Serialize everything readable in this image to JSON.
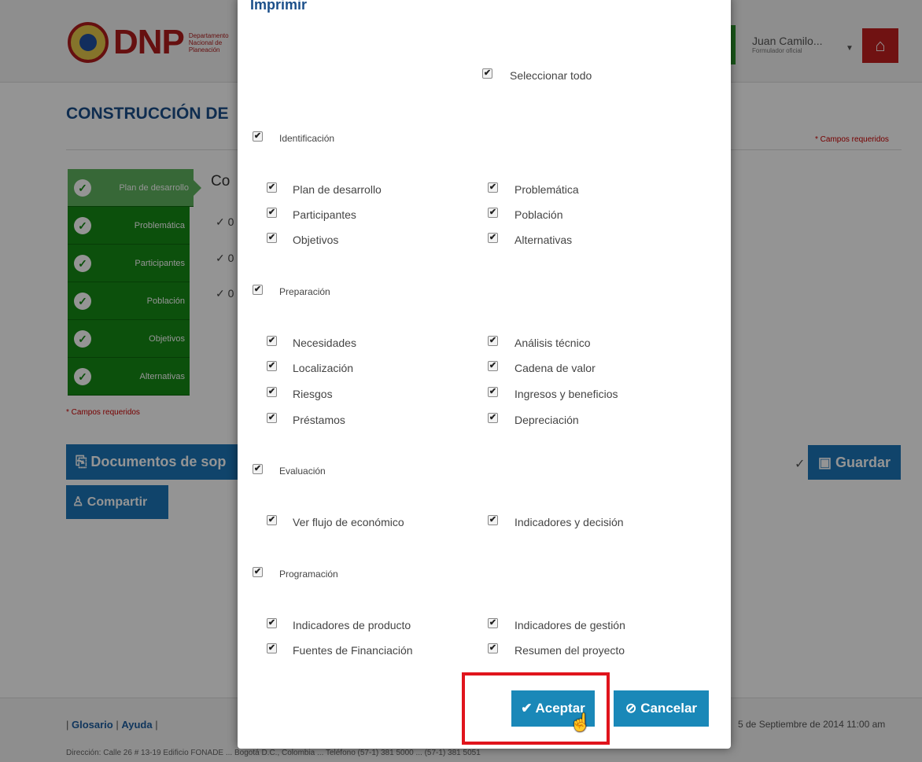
{
  "header": {
    "logo_text": "DNP",
    "logo_subtitle": "Departamento Nacional de Planeación",
    "user_name": "Juan Camilo...",
    "user_role": "Formulador oficial",
    "home_icon": "home-icon"
  },
  "page": {
    "title": "CONSTRUCCIÓN DE",
    "subtitle": "Co",
    "required_right": "* Campos requeridos",
    "required_left": "* Campos requeridos",
    "checks": [
      "✓ 0",
      "✓ 0",
      "✓ 0"
    ],
    "steps": [
      "Plan de desarrollo",
      "Problemática",
      "Participantes",
      "Población",
      "Objetivos",
      "Alternativas"
    ],
    "docs_button": "Documentos de sop",
    "share_button": "Compartir",
    "save_button": "Guardar"
  },
  "footer": {
    "glossary": "Glosario",
    "help": "Ayuda",
    "date": "5 de Septiembre de 2014 11:00 am",
    "address": "Dirección: Calle 26 # 13-19 Edificio FONADE ... Bogotá D.C., Colombia ... Teléfono (57-1) 381 5000 ... (57-1) 381 5051"
  },
  "modal": {
    "title": "Imprimir",
    "select_all": "Seleccionar todo",
    "sections": [
      {
        "label": "Identificación",
        "left": [
          "Plan de desarrollo",
          "Participantes",
          "Objetivos"
        ],
        "right": [
          "Problemática",
          "Población",
          "Alternativas"
        ]
      },
      {
        "label": "Preparación",
        "left": [
          "Necesidades",
          "Localización",
          "Riesgos",
          "Préstamos"
        ],
        "right": [
          "Análisis técnico",
          "Cadena de valor",
          "Ingresos y beneficios",
          "Depreciación"
        ]
      },
      {
        "label": "Evaluación",
        "left": [
          "Ver flujo de económico"
        ],
        "right": [
          "Indicadores y decisión"
        ]
      },
      {
        "label": "Programación",
        "left": [
          "Indicadores de producto",
          "Fuentes de Financiación"
        ],
        "right": [
          "Indicadores de gestión",
          "Resumen del proyecto"
        ]
      }
    ],
    "accept_button": "Aceptar",
    "cancel_button": "Cancelar",
    "checked": true
  },
  "colors": {
    "primary_blue": "#1a88b8",
    "step_green": "#168a16",
    "brand_red": "#c21f1f",
    "highlight_red": "#e0141c"
  }
}
